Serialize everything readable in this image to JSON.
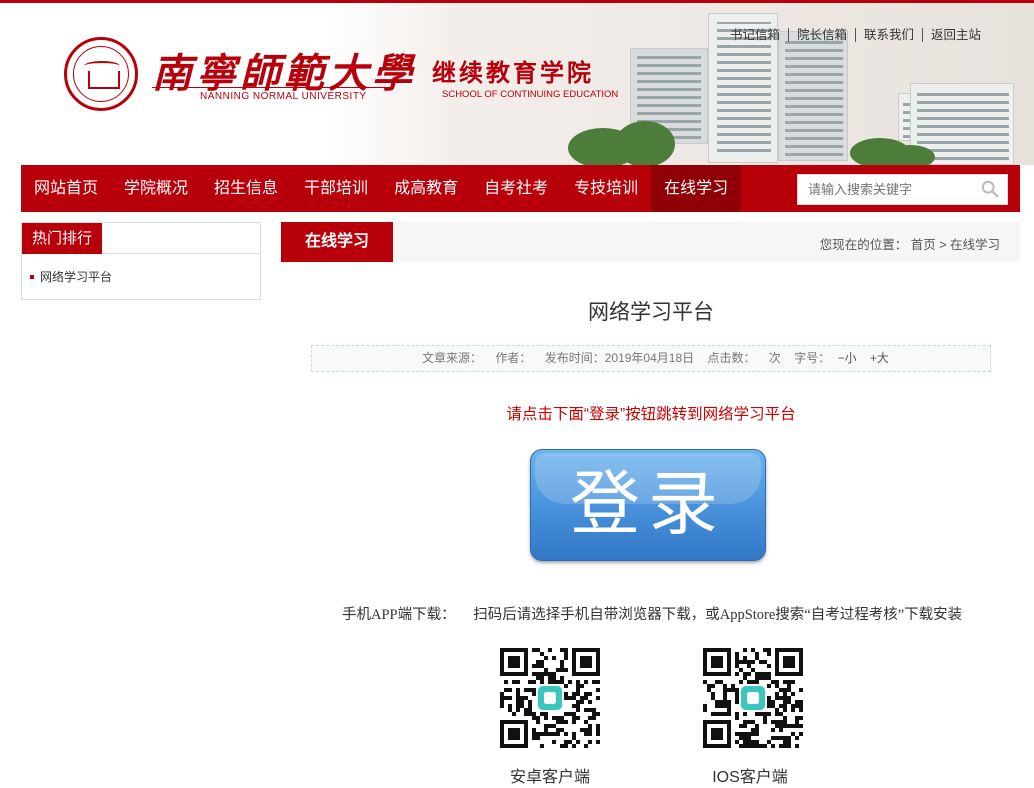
{
  "header": {
    "university_cn": "南寧師範大學",
    "university_en": "NANNING NORMAL UNIVERSITY",
    "college_cn": "继续教育学院",
    "college_en": "SCHOOL OF CONTINUING EDUCATION",
    "top_links": [
      "书记信箱",
      "院长信箱",
      "联系我们",
      "返回主站"
    ]
  },
  "nav": {
    "items": [
      "网站首页",
      "学院概况",
      "招生信息",
      "干部培训",
      "成高教育",
      "自考社考",
      "专技培训",
      "在线学习"
    ],
    "active_index": 7
  },
  "search": {
    "placeholder": "请输入搜索关键字"
  },
  "sidebar": {
    "title": "热门排行",
    "items": [
      "网络学习平台"
    ]
  },
  "main": {
    "section_title": "在线学习",
    "breadcrumb_prefix": "您现在的位置：",
    "breadcrumb_home": "首页",
    "breadcrumb_sep": ">",
    "breadcrumb_current": "在线学习",
    "article_title": "网络学习平台",
    "meta": {
      "source_label": "文章来源：",
      "author_label": "作者：",
      "date_label": "发布时间：",
      "date_value": "2019年04月18日",
      "clicks_label": "点击数：",
      "clicks_unit": "次",
      "font_label": "字号：",
      "font_small": "−小",
      "font_large": "+大"
    },
    "notice": "请点击下面“登录”按钮跳转到网络学习平台",
    "login_label": "登录",
    "app_label": "手机APP端下载：",
    "app_instruction": "扫码后请选择手机自带浏览器下载，或AppStore搜索“自考过程考核”下载安装",
    "qr_codes": [
      {
        "caption": "安卓客户端"
      },
      {
        "caption": "IOS客户端"
      }
    ]
  },
  "colors": {
    "brand_red": "#b8000b",
    "nav_active": "#8e0006",
    "notice_red": "#cc0000",
    "login_blue": "#4a93dc"
  }
}
